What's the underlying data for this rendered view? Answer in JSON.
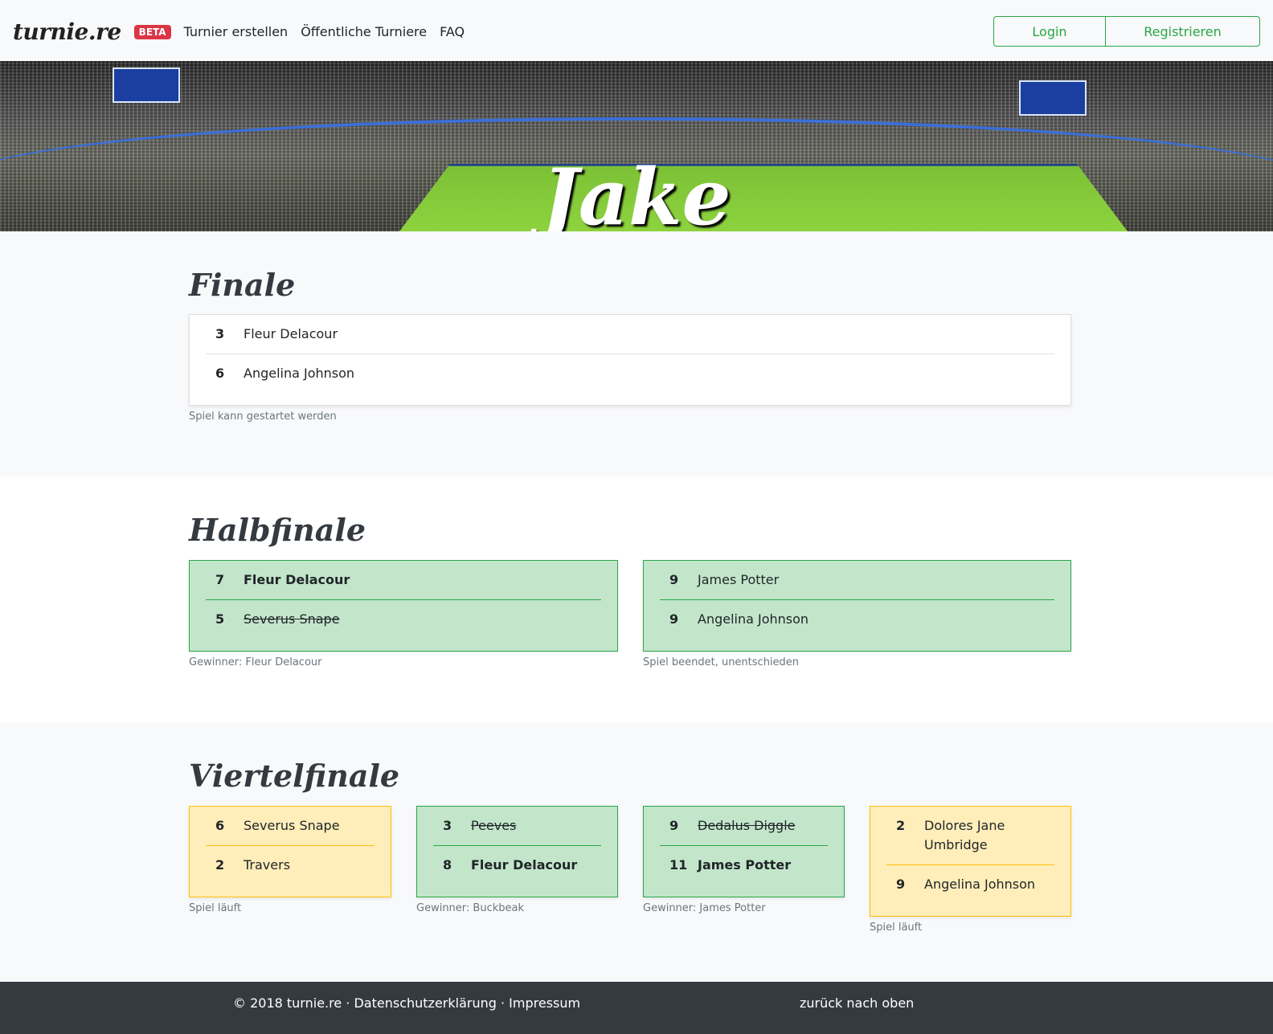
{
  "navbar": {
    "brand": "turnie.re",
    "badge": "BETA",
    "links": [
      "Turnier erstellen",
      "Öffentliche Turniere",
      "FAQ"
    ],
    "login": "Login",
    "register": "Registrieren"
  },
  "hero": {
    "title": "Jake"
  },
  "stages": {
    "final": {
      "title": "Finale",
      "matches": [
        {
          "a_score": "3",
          "a_team": "Fleur Delacour",
          "b_score": "6",
          "b_team": "Angelina Johnson",
          "caption": "Spiel kann gestartet werden"
        }
      ]
    },
    "semi": {
      "title": "Halbfinale",
      "matches": [
        {
          "a_score": "7",
          "a_team": "Fleur Delacour",
          "b_score": "5",
          "b_team": "Severus Snape",
          "caption": "Gewinner: Fleur Delacour"
        },
        {
          "a_score": "9",
          "a_team": "James Potter",
          "b_score": "9",
          "b_team": "Angelina Johnson",
          "caption": "Spiel beendet, unentschieden"
        }
      ]
    },
    "quarter": {
      "title": "Viertelfinale",
      "matches": [
        {
          "a_score": "6",
          "a_team": "Severus Snape",
          "b_score": "2",
          "b_team": "Travers",
          "caption": "Spiel läuft"
        },
        {
          "a_score": "3",
          "a_team": "Peeves",
          "b_score": "8",
          "b_team": "Fleur Delacour",
          "caption": "Gewinner: Buckbeak"
        },
        {
          "a_score": "9",
          "a_team": "Dedalus Diggle",
          "b_score": "11",
          "b_team": "James Potter",
          "caption": "Gewinner: James Potter"
        },
        {
          "a_score": "2",
          "a_team": "Dolores Jane Umbridge",
          "b_score": "9",
          "b_team": "Angelina Johnson",
          "caption": "Spiel läuft"
        }
      ]
    }
  },
  "footer": {
    "copyright": "© 2018 turnie.re",
    "separator": "·",
    "privacy": "Datenschutzerklärung",
    "imprint": "Impressum",
    "back_to_top": "zurück nach oben"
  },
  "colors": {
    "success": "#28a745",
    "warning": "#ffc107",
    "danger": "#dc3545",
    "footer": "#343a40"
  }
}
